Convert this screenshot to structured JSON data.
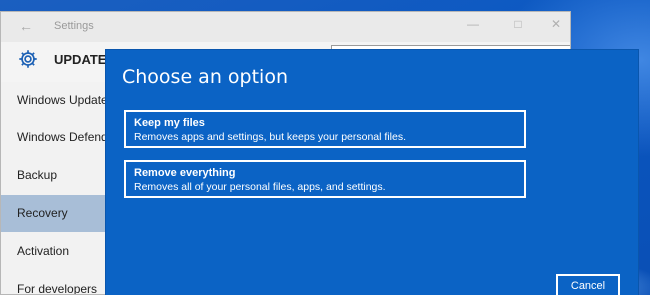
{
  "settings_window": {
    "title": "Settings",
    "back_icon": "back-arrow-icon",
    "minimize_icon": "minimize-icon",
    "maximize_icon": "maximize-icon",
    "close_icon": "close-icon",
    "section_icon": "gear-icon",
    "section_title": "UPDATE & SECURITY",
    "sidebar": {
      "items": [
        {
          "label": "Windows Update"
        },
        {
          "label": "Windows Defender"
        },
        {
          "label": "Backup"
        },
        {
          "label": "Recovery",
          "selected": true
        },
        {
          "label": "Activation"
        },
        {
          "label": "For developers"
        }
      ]
    }
  },
  "dialog": {
    "title": "Choose an option",
    "options": [
      {
        "title": "Keep my files",
        "description": "Removes apps and settings, but keeps your personal files."
      },
      {
        "title": "Remove everything",
        "description": "Removes all of your personal files, apps, and settings."
      }
    ],
    "cancel_label": "Cancel"
  },
  "colors": {
    "dialog_background": "#0b63c5",
    "selected_nav": "#a8bed7",
    "desktop": "#0a58c2"
  }
}
